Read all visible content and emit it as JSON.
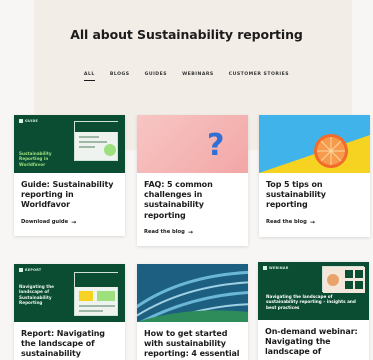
{
  "page": {
    "title": "All about Sustainability reporting"
  },
  "filters": [
    {
      "label": "ALL",
      "active": true
    },
    {
      "label": "BLOGS",
      "active": false
    },
    {
      "label": "GUIDES",
      "active": false
    },
    {
      "label": "WEBINARS",
      "active": false
    },
    {
      "label": "CUSTOMER STORIES",
      "active": false
    }
  ],
  "cards": [
    {
      "title": "Guide: Sustainability reporting in Worldfavor",
      "cta": "Download guide",
      "thumb": {
        "tag": "GUIDE",
        "text": "Sustainability Reporting in Worldfavor"
      }
    },
    {
      "title": "FAQ: 5 common challenges in sustainability reporting",
      "cta": "Read the blog"
    },
    {
      "title": "Top 5 tips on sustainability reporting",
      "cta": "Read the blog"
    },
    {
      "title": "Report: Navigating the landscape of sustainability",
      "cta": "",
      "thumb": {
        "tag": "REPORT",
        "text": "Navigating the landscape of Sustainability Reporting"
      }
    },
    {
      "title": "How to get started with sustainability reporting: 4 essential",
      "cta": ""
    },
    {
      "title": "On-demand webinar: Navigating the landscape of",
      "cta": "",
      "thumb": {
        "tag": "WEBINAR",
        "text": "Navigating the landscape of sustainability reporting – insights and best practices"
      }
    }
  ],
  "colors": {
    "brand_green": "#0b4d33",
    "accent_green": "#9fe07e",
    "pink": "#f7c6c4",
    "yellow": "#f6d321",
    "sky": "#3fb3ea",
    "orange": "#f26b2a"
  }
}
